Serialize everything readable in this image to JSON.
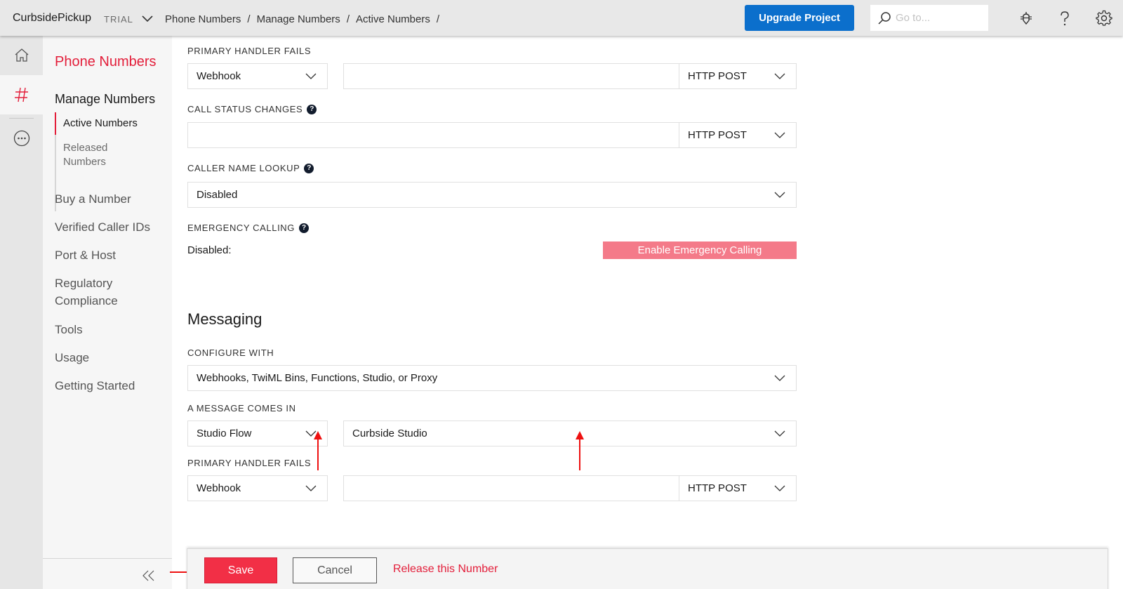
{
  "topbar": {
    "project_name": "CurbsidePickup",
    "plan_badge": "TRIAL",
    "breadcrumb": [
      "Phone Numbers",
      "Manage Numbers",
      "Active Numbers"
    ],
    "breadcrumb_separator": "/",
    "upgrade_label": "Upgrade Project",
    "search_placeholder": "Go to...",
    "icons": [
      "search-icon",
      "debugger-bug-icon",
      "help-icon",
      "settings-gear-icon"
    ]
  },
  "rail": {
    "items": [
      {
        "name": "home",
        "icon": "home-icon",
        "active": false
      },
      {
        "name": "phone-numbers",
        "icon": "hash-icon",
        "active": true
      },
      {
        "name": "more",
        "icon": "more-ellipsis-icon",
        "active": false
      }
    ]
  },
  "nav": {
    "title": "Phone Numbers",
    "section": "Manage Numbers",
    "sub_items": [
      {
        "label": "Active Numbers",
        "active": true
      },
      {
        "label": "Released Numbers",
        "active": false
      }
    ],
    "items": [
      "Buy a Number",
      "Verified Caller IDs",
      "Port & Host",
      "Regulatory Compliance",
      "Tools",
      "Usage",
      "Getting Started"
    ],
    "collapse_icon": "double-chevron-left-icon"
  },
  "voice": {
    "primary_handler_fails": {
      "label": "PRIMARY HANDLER FAILS",
      "type": "Webhook",
      "url": "",
      "method": "HTTP POST"
    },
    "call_status_changes": {
      "label": "CALL STATUS CHANGES",
      "url": "",
      "method": "HTTP POST",
      "help": "?"
    },
    "caller_name_lookup": {
      "label": "CALLER NAME LOOKUP",
      "value": "Disabled",
      "help": "?"
    },
    "emergency_calling": {
      "label": "EMERGENCY CALLING",
      "status": "Disabled:",
      "button_label": "Enable Emergency Calling",
      "help": "?"
    }
  },
  "messaging": {
    "title": "Messaging",
    "configure_with": {
      "label": "CONFIGURE WITH",
      "value": "Webhooks, TwiML Bins, Functions, Studio, or Proxy"
    },
    "message_comes_in": {
      "label": "A MESSAGE COMES IN",
      "type": "Studio Flow",
      "flow": "Curbside Studio"
    },
    "primary_handler_fails": {
      "label": "PRIMARY HANDLER FAILS",
      "type": "Webhook",
      "url": "",
      "method": "HTTP POST"
    }
  },
  "actions": {
    "save_label": "Save",
    "cancel_label": "Cancel",
    "release_label": "Release this Number"
  },
  "colors": {
    "brand_red": "#e31e3a",
    "save_red": "#f22f46",
    "upgrade_blue": "#0b6fcc",
    "emergency_pink": "#f47a89",
    "annotation_red": "#ee1111"
  }
}
